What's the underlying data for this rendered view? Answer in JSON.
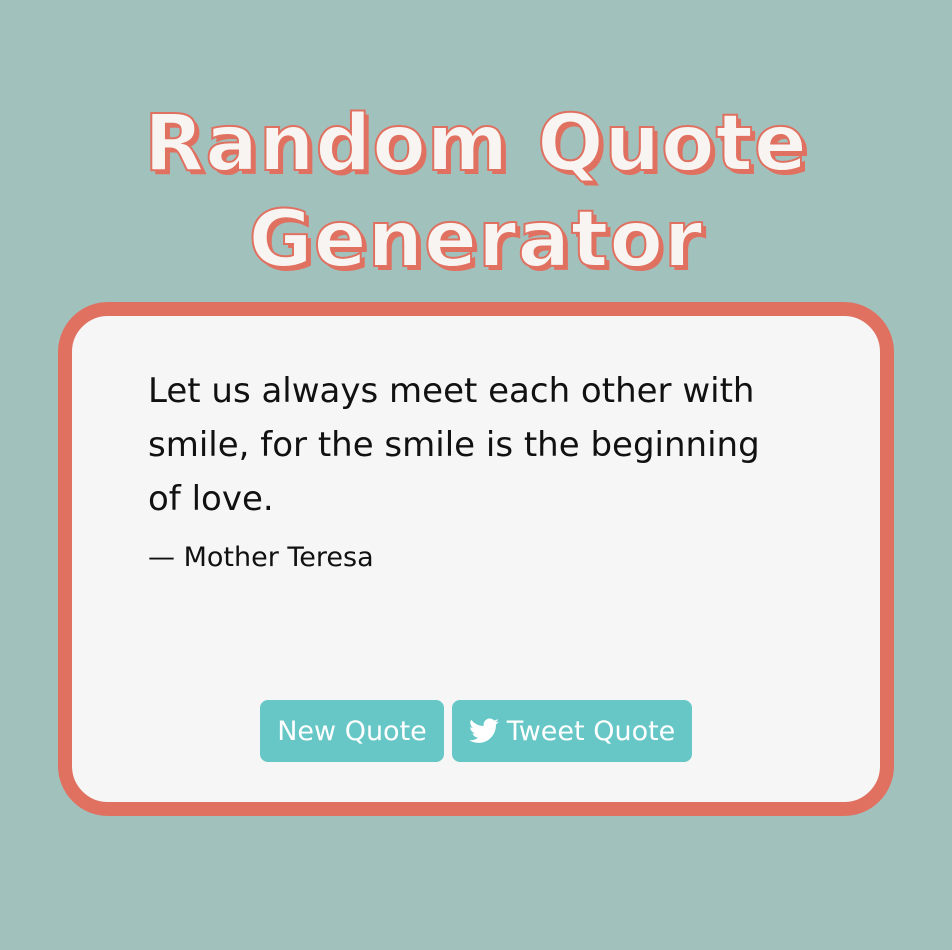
{
  "header": {
    "title_line1": "Random Quote",
    "title_line2": "Generator"
  },
  "quote": {
    "text": "Let us always meet each other with smile, for the smile is the beginning of love.",
    "author": "— Mother Teresa"
  },
  "buttons": {
    "new_quote_label": "New Quote",
    "tweet_quote_label": "Tweet Quote",
    "tweet_icon": "twitter-icon"
  },
  "colors": {
    "background": "#a1c1bd",
    "accent": "#e07161",
    "card": "#f6f6f6",
    "button": "#67c6c6"
  }
}
